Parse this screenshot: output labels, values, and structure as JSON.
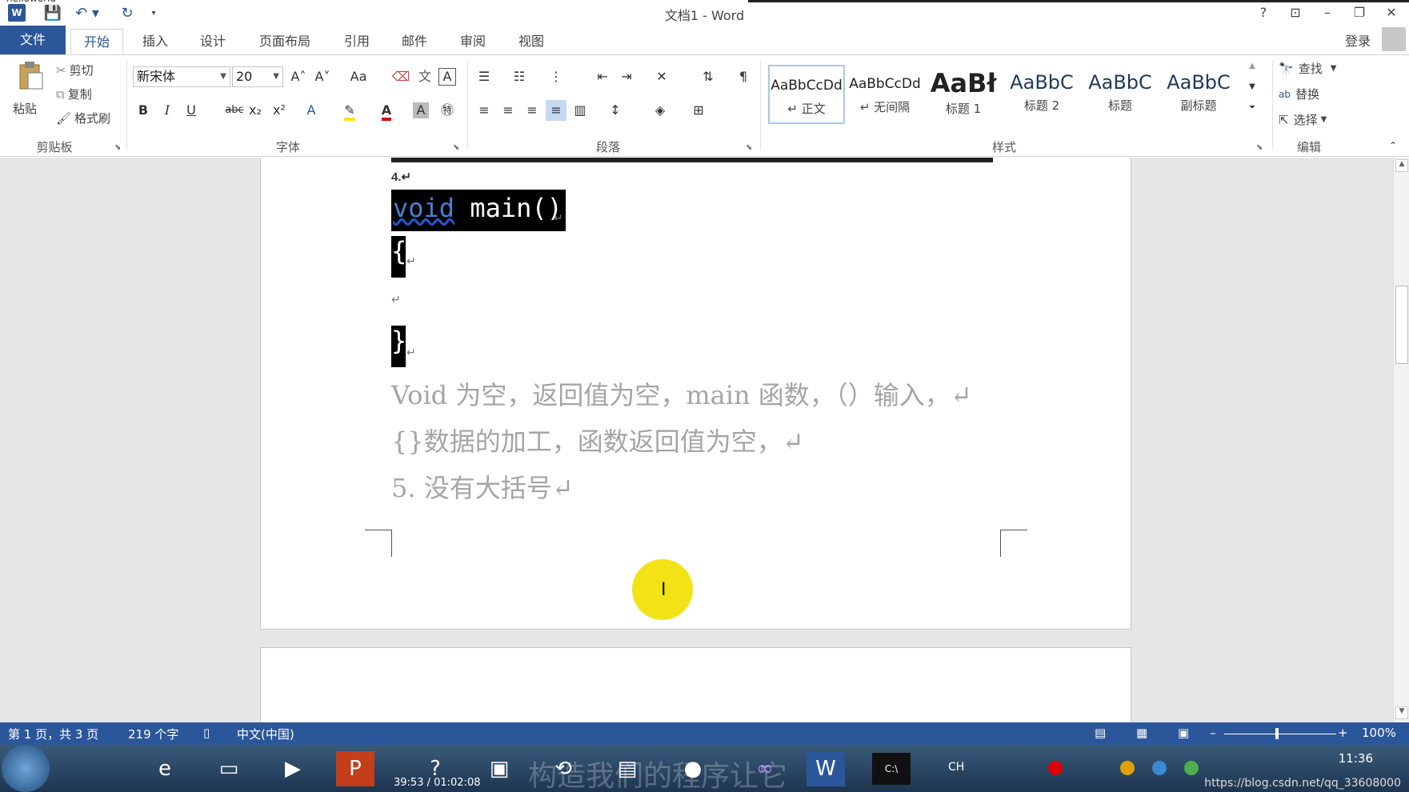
{
  "window": {
    "title": "文档1 - Word",
    "partial_title": "helloworld",
    "help": "?",
    "ribbon_display": "⊡",
    "minimize": "–",
    "restore": "❐",
    "close": "✕"
  },
  "quick_access": {
    "app_icon": "W",
    "save": "💾",
    "undo": "↶ ▾",
    "redo": "↻",
    "customize": "▾"
  },
  "tabs": [
    {
      "label": "文件"
    },
    {
      "label": "开始"
    },
    {
      "label": "插入"
    },
    {
      "label": "设计"
    },
    {
      "label": "页面布局"
    },
    {
      "label": "引用"
    },
    {
      "label": "邮件"
    },
    {
      "label": "审阅"
    },
    {
      "label": "视图"
    }
  ],
  "account": {
    "signin": "登录"
  },
  "ribbon": {
    "clipboard": {
      "label": "剪贴板",
      "paste": "粘贴",
      "cut": "剪切",
      "copy": "复制",
      "format_painter": "格式刷"
    },
    "font": {
      "label": "字体",
      "font_name": "新宋体",
      "font_size": "20",
      "grow": "A˄",
      "shrink": "A˅",
      "change_case": "Aa",
      "bold": "B",
      "italic": "I",
      "underline": "U",
      "strike": "abc",
      "subscript": "x₂",
      "superscript": "x²"
    },
    "paragraph": {
      "label": "段落"
    },
    "styles": {
      "label": "样式",
      "items": [
        {
          "sample": "AaBbCcDd",
          "name": "↵ 正文"
        },
        {
          "sample": "AaBbCcDd",
          "name": "↵ 无间隔"
        },
        {
          "sample": "AaBł",
          "name": "标题 1"
        },
        {
          "sample": "AaBbC",
          "name": "标题 2"
        },
        {
          "sample": "AaBbC",
          "name": "标题"
        },
        {
          "sample": "AaBbC",
          "name": "副标题"
        }
      ]
    },
    "editing": {
      "label": "编辑",
      "find": "查找",
      "replace": "替换",
      "select": "选择"
    }
  },
  "document": {
    "num4": "4.↵",
    "code_kw": "void",
    "code_rest": " main()",
    "brace_open": "{",
    "brace_close": "}",
    "para_mark": "↵",
    "line1": "Void 为空，返回值为空，main 函数，（）输入，↵",
    "line2": "{}数据的加工，函数返回值为空，↵",
    "line3": "5. 没有大括号↵"
  },
  "status": {
    "page": "第 1 页，共 3 页",
    "words": "219 个字",
    "language": "中文(中国)",
    "zoom": "100%",
    "zoom_minus": "–",
    "zoom_plus": "+"
  },
  "taskbar": {
    "player_time": "39:53 / 01:02:08",
    "lang": "CH",
    "clock": "11:36",
    "url": "https://blog.csdn.net/qq_33608000",
    "subtitle_ghost": "构造我们的程序让它"
  }
}
